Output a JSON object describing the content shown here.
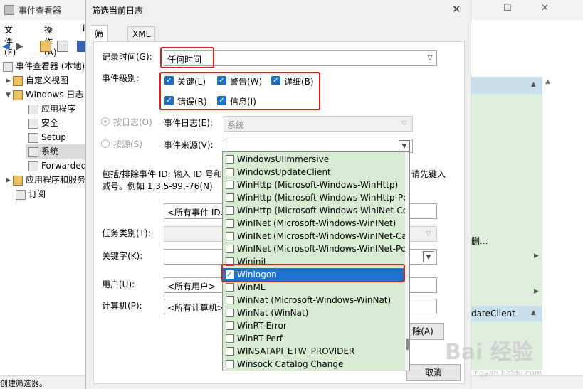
{
  "background": {
    "window_title": "事件查看器",
    "menu": [
      "文件(F)",
      "操作(A)",
      "i"
    ],
    "tree": {
      "root": "事件查看器 (本地)",
      "custom_views": "自定义视图",
      "windows_logs": "Windows 日志",
      "logs": [
        "应用程序",
        "安全",
        "Setup",
        "系统",
        "Forwarded"
      ],
      "app_services": "应用程序和服务",
      "subscriptions": "订阅"
    },
    "status_text": "创建筛选器。",
    "action_fragments": {
      "more": "删...",
      "selected_item": "dateClient"
    }
  },
  "dialog": {
    "title": "筛选当前日志",
    "tabs": [
      "筛选器",
      "XML"
    ],
    "logged_label": "记录时间(G):",
    "logged_value": "任何时间",
    "level_label": "事件级别:",
    "levels": {
      "critical": "关键(L)",
      "warning": "警告(W)",
      "verbose": "详细(B)",
      "error": "错误(R)",
      "info": "信息(I)"
    },
    "by_log_label": "按日志(O)",
    "event_log_label": "事件日志(E):",
    "event_log_value": "系统",
    "by_source_label": "按源(S)",
    "event_source_label": "事件来源(V):",
    "include_text_1": "包括/排除事件 ID: 输入 ID 号和",
    "include_text_1b": "请先键入",
    "include_text_2": "减号。例如 1,3,5-99,-76(N)",
    "event_id_value": "<所有事件 ID>",
    "task_label": "任务类别(T):",
    "keywords_label": "关键字(K):",
    "user_label": "用户(U):",
    "user_value": "<所有用户>",
    "computer_label": "计算机(P):",
    "computer_value": "<所有计算机>",
    "clear_button": "除(A)",
    "cancel_button": "取消"
  },
  "source_list": [
    "WindowsUIImmersive",
    "WindowsUpdateClient",
    "WinHttp (Microsoft-Windows-WinHttp)",
    "WinHttp (Microsoft-Windows-WinHttp-Pca",
    "WinHttp (Microsoft-Windows-WinINet-Cor",
    "WinINet (Microsoft-Windows-WinINet)",
    "WinINet (Microsoft-Windows-WinINet-Cap",
    "WinINet (Microsoft-Windows-WinINet-Pca",
    "Wininit",
    "Winlogon",
    "WinML",
    "WinNat (Microsoft-Windows-WinNat)",
    "WinNat (WinNat)",
    "WinRT-Error",
    "WinRT-Perf",
    "WINSATAPI_ETW_PROVIDER",
    "Winsock Catalog Change"
  ],
  "selected_source_index": 9,
  "watermark": {
    "text": "Bai 经验",
    "url": "jingyan.baidu.com"
  }
}
